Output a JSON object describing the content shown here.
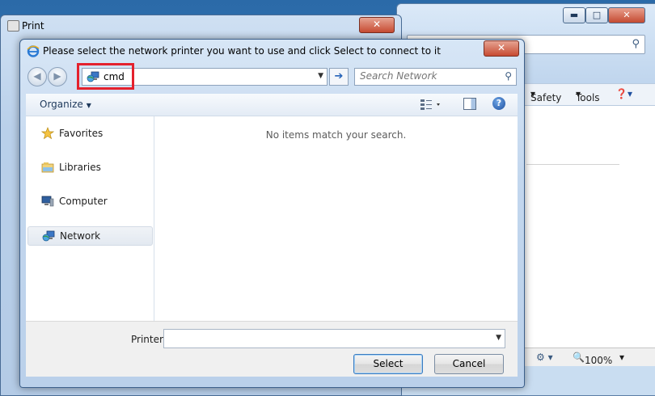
{
  "browser": {
    "menu": {
      "safety": "Safety",
      "tools": "Tools"
    },
    "zoom": "100%"
  },
  "print_window": {
    "title": "Print"
  },
  "dialog": {
    "title": "Please select the network printer you want to use and click Select to connect to it",
    "address": {
      "value": "cmd"
    },
    "search": {
      "placeholder": "Search Network"
    },
    "toolbar": {
      "organize": "Organize"
    },
    "nav": [
      {
        "label": "Favorites",
        "icon": "star-icon"
      },
      {
        "label": "Libraries",
        "icon": "libraries-icon"
      },
      {
        "label": "Computer",
        "icon": "computer-icon"
      },
      {
        "label": "Network",
        "icon": "network-icon",
        "selected": true
      }
    ],
    "content": {
      "empty_message": "No items match your search."
    },
    "printer_label": "Printer",
    "printer_value": "",
    "buttons": {
      "select": "Select",
      "cancel": "Cancel"
    }
  },
  "colors": {
    "highlight_box": "#e4212d",
    "accent": "#2563b8"
  }
}
